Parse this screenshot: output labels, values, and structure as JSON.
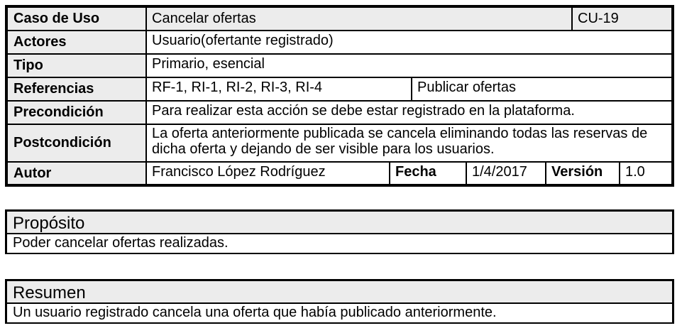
{
  "use_case": {
    "label": "Caso de Uso",
    "name": "Cancelar ofertas",
    "code": "CU-19"
  },
  "actors": {
    "label": "Actores",
    "value": "Usuario(ofertante registrado)"
  },
  "type": {
    "label": "Tipo",
    "value": "Primario, esencial"
  },
  "references": {
    "label": "Referencias",
    "value": "RF-1, RI-1, RI-2, RI-3, RI-4",
    "related": "Publicar ofertas"
  },
  "precondition": {
    "label": "Precondición",
    "value": "Para realizar esta acción se debe estar registrado en la plataforma."
  },
  "postcondition": {
    "label": "Postcondición",
    "value": "La oferta anteriormente publicada se cancela eliminando todas las reservas de dicha oferta y dejando de ser visible para los usuarios."
  },
  "author": {
    "label": "Autor",
    "value": "Francisco López Rodríguez",
    "date_label": "Fecha",
    "date": "1/4/2017",
    "version_label": "Versión",
    "version": "1.0"
  },
  "purpose": {
    "title": "Propósito",
    "text": "Poder cancelar ofertas realizadas."
  },
  "summary": {
    "title": "Resumen",
    "text": "Un usuario registrado cancela una oferta que había publicado anteriormente."
  }
}
